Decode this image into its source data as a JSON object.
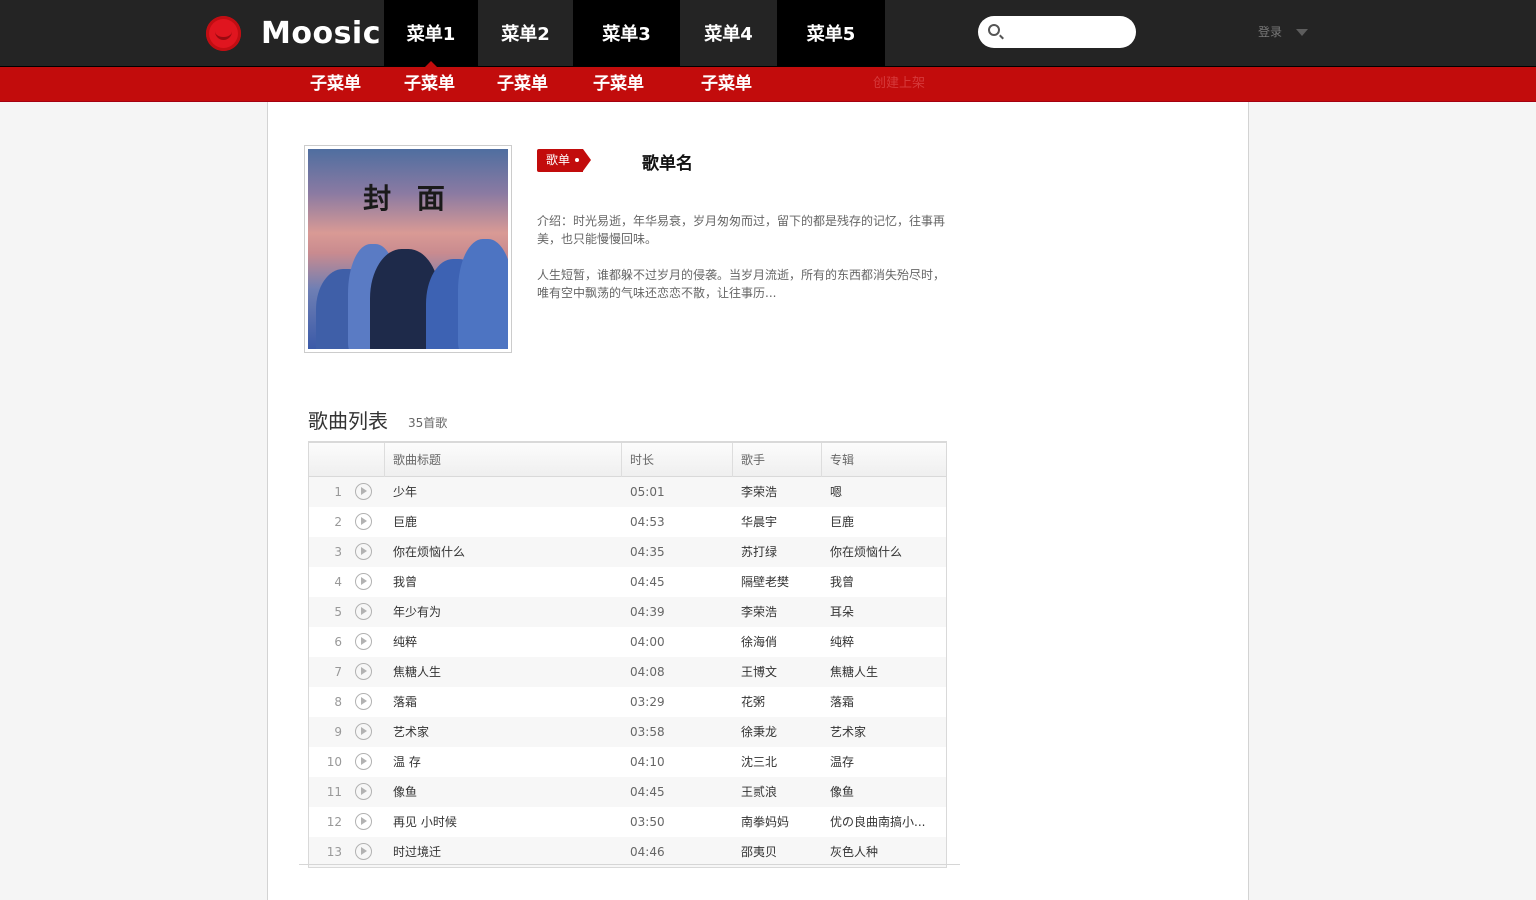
{
  "app": {
    "logo_text": "Moosic",
    "brand_color": "#c20c0c"
  },
  "topnav": {
    "items": [
      "菜单1",
      "菜单2",
      "菜单3",
      "菜单4",
      "菜单5"
    ],
    "active_index": 0,
    "search_placeholder": "",
    "login_label": "登录"
  },
  "subnav": {
    "items": [
      "子菜单",
      "子菜单",
      "子菜单",
      "子菜单",
      "子菜单",
      "创建上架"
    ]
  },
  "playlist": {
    "cover_label": "封 面",
    "tag_label": "歌单",
    "name": "歌单名",
    "desc_1": "介绍：时光易逝，年华易衰，岁月匆匆而过，留下的都是残存的记忆，往事再美，也只能慢慢回味。",
    "desc_2": "人生短暂，谁都躲不过岁月的侵袭。当岁月流逝，所有的东西都消失殆尽时，唯有空中飘荡的气味还恋恋不散，让往事历..."
  },
  "songs": {
    "title": "歌曲列表",
    "count_label": "35首歌",
    "columns": [
      "歌曲标题",
      "时长",
      "歌手",
      "专辑"
    ],
    "rows": [
      {
        "num": "1",
        "title": "少年",
        "duration": "05:01",
        "artist": "李荣浩",
        "album": "嗯"
      },
      {
        "num": "2",
        "title": "巨鹿",
        "duration": "04:53",
        "artist": "华晨宇",
        "album": "巨鹿"
      },
      {
        "num": "3",
        "title": "你在烦恼什么",
        "duration": "04:35",
        "artist": "苏打绿",
        "album": "你在烦恼什么"
      },
      {
        "num": "4",
        "title": "我曾",
        "duration": "04:45",
        "artist": "隔壁老樊",
        "album": "我曾"
      },
      {
        "num": "5",
        "title": "年少有为",
        "duration": "04:39",
        "artist": "李荣浩",
        "album": "耳朵"
      },
      {
        "num": "6",
        "title": "纯粹",
        "duration": "04:00",
        "artist": "徐海俏",
        "album": "纯粹"
      },
      {
        "num": "7",
        "title": "焦糖人生",
        "duration": "04:08",
        "artist": "王博文",
        "album": "焦糖人生"
      },
      {
        "num": "8",
        "title": "落霜",
        "duration": "03:29",
        "artist": "花粥",
        "album": "落霜"
      },
      {
        "num": "9",
        "title": "艺术家",
        "duration": "03:58",
        "artist": "徐秉龙",
        "album": "艺术家"
      },
      {
        "num": "10",
        "title": "温 存",
        "duration": "04:10",
        "artist": "沈三北",
        "album": "温存"
      },
      {
        "num": "11",
        "title": "像鱼",
        "duration": "04:45",
        "artist": "王贰浪",
        "album": "像鱼"
      },
      {
        "num": "12",
        "title": "再见 小时候",
        "duration": "03:50",
        "artist": "南拳妈妈",
        "album": "优の良曲南搞小..."
      },
      {
        "num": "13",
        "title": "时过境迁",
        "duration": "04:46",
        "artist": "邵夷贝",
        "album": "灰色人种"
      }
    ]
  }
}
